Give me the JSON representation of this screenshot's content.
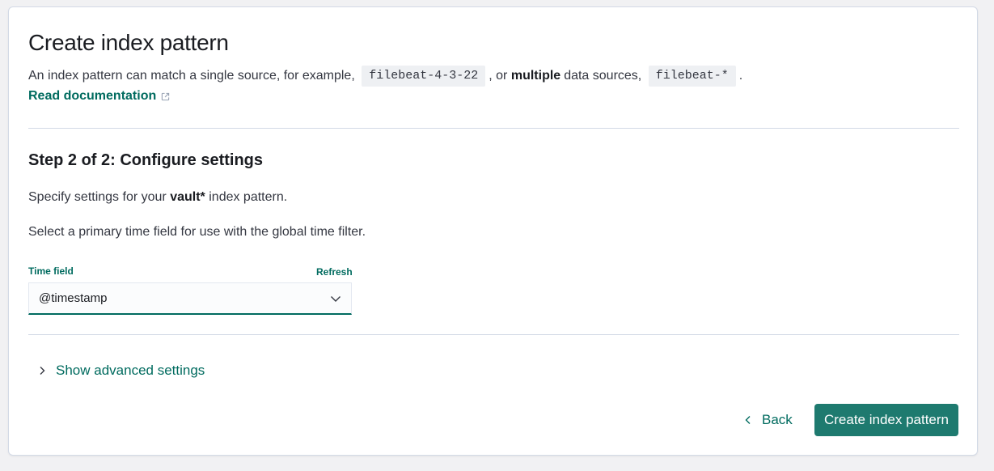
{
  "header": {
    "title": "Create index pattern",
    "description_prefix": "An index pattern can match a single source, for example,",
    "example_single": "filebeat-4-3-22",
    "description_middle": ", or",
    "description_bold": "multiple",
    "description_suffix": "data sources,",
    "example_multiple": "filebeat-*",
    "description_end": ".",
    "doc_link": "Read documentation",
    "doc_link_icon": "external-link-icon"
  },
  "step": {
    "title": "Step 2 of 2: Configure settings",
    "specify_prefix": "Specify settings for your",
    "pattern_name": "vault*",
    "specify_suffix": "index pattern.",
    "time_instruction": "Select a primary time field for use with the global time filter."
  },
  "time_field": {
    "label": "Time field",
    "refresh_label": "Refresh",
    "selected_value": "@timestamp",
    "dropdown_icon": "chevron-down-icon"
  },
  "advanced": {
    "label": "Show advanced settings",
    "icon": "chevron-right-icon"
  },
  "footer": {
    "back_label": "Back",
    "back_icon": "chevron-left-icon",
    "create_label": "Create index pattern"
  },
  "colors": {
    "accent": "#006b5f",
    "primary_button": "#1e7a6f",
    "page_background": "#f1f1f3",
    "panel_background": "#ffffff"
  }
}
